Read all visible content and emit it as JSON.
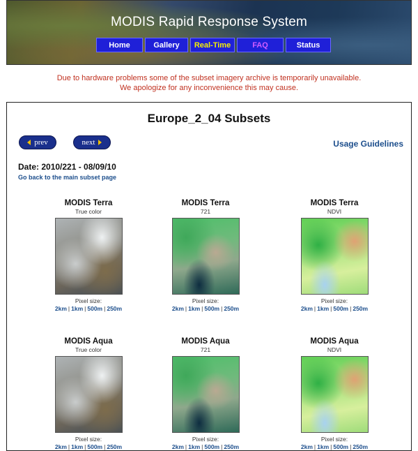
{
  "header": {
    "title": "MODIS Rapid Response System",
    "nav": [
      "Home",
      "Gallery",
      "Real-Time",
      "FAQ",
      "Status"
    ]
  },
  "notice": {
    "line1": "Due to hardware problems some of the subset imagery archive is temporarily unavailable.",
    "line2": "We apologize for any inconvenience this may cause."
  },
  "panel": {
    "title": "Europe_2_04 Subsets",
    "prev_label": "prev",
    "next_label": "next",
    "usage_label": "Usage Guidelines",
    "date": "Date: 2010/221 - 08/09/10",
    "back_link": "Go back to the main subset page"
  },
  "grid": [
    {
      "satellite": "MODIS Terra",
      "band": "True color"
    },
    {
      "satellite": "MODIS Terra",
      "band": "721"
    },
    {
      "satellite": "MODIS Terra",
      "band": "NDVI"
    },
    {
      "satellite": "MODIS Aqua",
      "band": "True color"
    },
    {
      "satellite": "MODIS Aqua",
      "band": "721"
    },
    {
      "satellite": "MODIS Aqua",
      "band": "NDVI"
    }
  ],
  "pixel_size_label": "Pixel size:",
  "sizes": [
    "2km",
    "1km",
    "500m",
    "250m"
  ],
  "colors": {
    "nav_bg": "#1f20d8",
    "notice": "#c0301f",
    "link": "#1c4e8c",
    "pill": "#1a2f8c"
  }
}
